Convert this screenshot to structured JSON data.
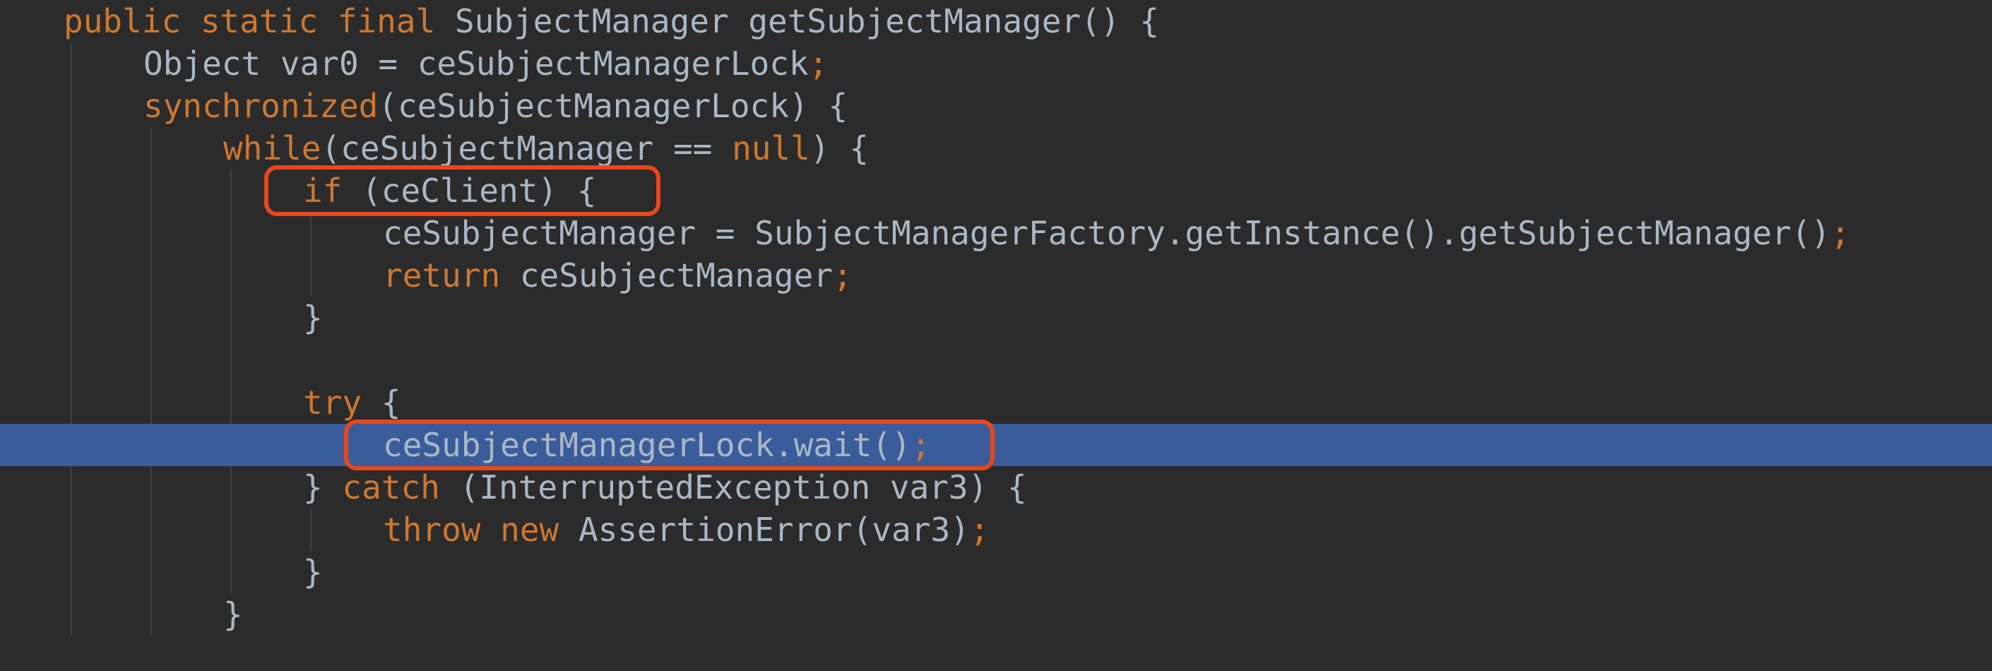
{
  "editor": {
    "language": "java",
    "colors": {
      "background": "#2b2b2b",
      "keyword": "#cc7832",
      "text": "#a9b7c6",
      "current_line": "#3a5c9a",
      "annotation_box": "#e8471c"
    },
    "current_line_index": 10,
    "annotated_line_indices": [
      4,
      10
    ],
    "lines": [
      {
        "indent": 0,
        "tokens": [
          {
            "t": "public static final",
            "k": "kw"
          },
          {
            "t": " SubjectManager getSubjectManager() {",
            "k": "plain"
          }
        ]
      },
      {
        "indent": 1,
        "tokens": [
          {
            "t": "Object var0 = ceSubjectManagerLock",
            "k": "plain"
          },
          {
            "t": ";",
            "k": "punct"
          }
        ]
      },
      {
        "indent": 1,
        "tokens": [
          {
            "t": "synchronized",
            "k": "kw"
          },
          {
            "t": "(ceSubjectManagerLock) {",
            "k": "plain"
          }
        ]
      },
      {
        "indent": 2,
        "tokens": [
          {
            "t": "while",
            "k": "kw"
          },
          {
            "t": "(ceSubjectManager == ",
            "k": "plain"
          },
          {
            "t": "null",
            "k": "kw"
          },
          {
            "t": ") {",
            "k": "plain"
          }
        ]
      },
      {
        "indent": 3,
        "tokens": [
          {
            "t": "if",
            "k": "kw"
          },
          {
            "t": " (ceClient) {",
            "k": "plain"
          }
        ]
      },
      {
        "indent": 4,
        "tokens": [
          {
            "t": "ceSubjectManager = SubjectManagerFactory.getInstance().getSubjectManager()",
            "k": "plain"
          },
          {
            "t": ";",
            "k": "punct"
          }
        ]
      },
      {
        "indent": 4,
        "tokens": [
          {
            "t": "return",
            "k": "kw"
          },
          {
            "t": " ceSubjectManager",
            "k": "plain"
          },
          {
            "t": ";",
            "k": "punct"
          }
        ]
      },
      {
        "indent": 3,
        "tokens": [
          {
            "t": "}",
            "k": "plain"
          }
        ]
      },
      {
        "indent": 0,
        "tokens": []
      },
      {
        "indent": 3,
        "tokens": [
          {
            "t": "try",
            "k": "kw"
          },
          {
            "t": " {",
            "k": "plain"
          }
        ]
      },
      {
        "indent": 4,
        "tokens": [
          {
            "t": "ceSubjectManagerLock.wait()",
            "k": "plain"
          },
          {
            "t": ";",
            "k": "punct"
          }
        ]
      },
      {
        "indent": 3,
        "tokens": [
          {
            "t": "} ",
            "k": "plain"
          },
          {
            "t": "catch",
            "k": "kw"
          },
          {
            "t": " (InterruptedException var3) {",
            "k": "plain"
          }
        ]
      },
      {
        "indent": 4,
        "tokens": [
          {
            "t": "throw new",
            "k": "kw"
          },
          {
            "t": " AssertionError(var3)",
            "k": "plain"
          },
          {
            "t": ";",
            "k": "punct"
          }
        ]
      },
      {
        "indent": 3,
        "tokens": [
          {
            "t": "}",
            "k": "plain"
          }
        ]
      },
      {
        "indent": 2,
        "tokens": [
          {
            "t": "}",
            "k": "plain"
          }
        ]
      },
      {
        "indent": 0,
        "tokens": []
      }
    ]
  }
}
